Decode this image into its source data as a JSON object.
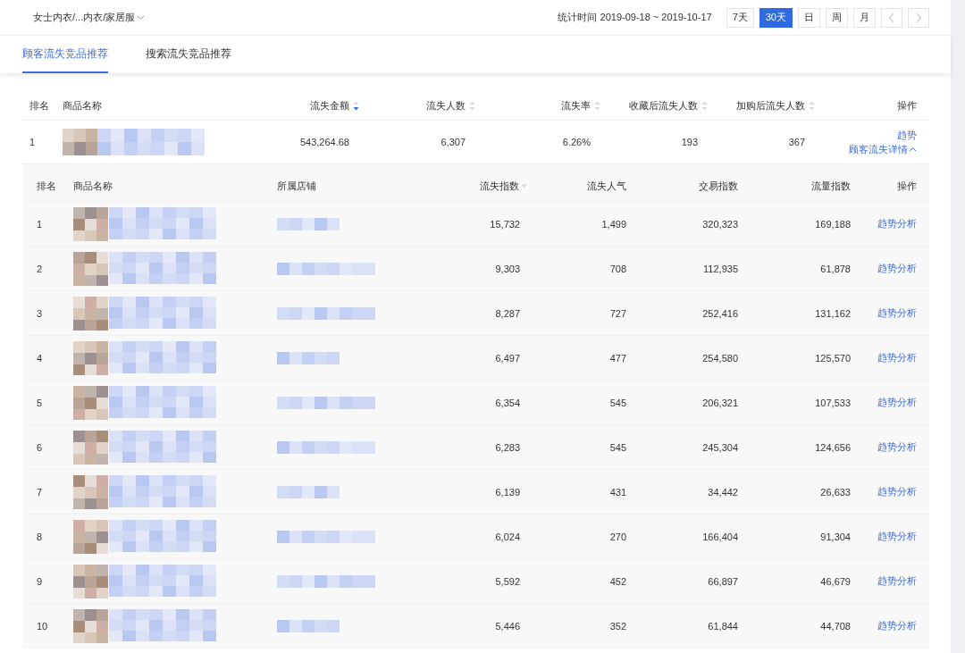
{
  "header": {
    "category": "女士内衣/...内衣/家居服",
    "period_label": "统计时间 2019-09-18 ~ 2019-10-17",
    "ranges": [
      {
        "label": "7天",
        "selected": false
      },
      {
        "label": "30天",
        "selected": true
      },
      {
        "label": "日",
        "selected": false
      },
      {
        "label": "周",
        "selected": false
      },
      {
        "label": "月",
        "selected": false
      }
    ],
    "prev_disabled": true,
    "next_disabled": true
  },
  "tabs": [
    {
      "label": "顾客流失竞品推荐",
      "selected": true
    },
    {
      "label": "搜索流失竞品推荐",
      "selected": false
    }
  ],
  "table": {
    "columns": [
      {
        "label": "排名",
        "sortable": false
      },
      {
        "label": "商品名称",
        "sortable": false
      },
      {
        "label": "流失金额",
        "sortable": true,
        "sorted_desc": true
      },
      {
        "label": "流失人数",
        "sortable": true,
        "sorted_desc": false
      },
      {
        "label": "流失率",
        "sortable": true,
        "sorted_desc": false
      },
      {
        "label": "收藏后流失人数",
        "sortable": true,
        "sorted_desc": false
      },
      {
        "label": "加购后流失人数",
        "sortable": true,
        "sorted_desc": false
      },
      {
        "label": "操作",
        "sortable": false
      }
    ],
    "rows": [
      {
        "rank": "1",
        "amount": "543,264.68",
        "lost_users": "6,307",
        "rate": "6.26%",
        "after_fav": "193",
        "after_cart": "367",
        "links": [
          "趋势",
          "顾客流失详情"
        ],
        "expanded": true
      }
    ]
  },
  "detail": {
    "columns": [
      "排名",
      "商品名称",
      "所属店铺",
      "流失指数",
      "流失人气",
      "交易指数",
      "流量指数",
      "操作"
    ],
    "rows": [
      {
        "rank": "1",
        "loss_index": "15,732",
        "popularity": "1,499",
        "trade_index": "320,323",
        "traffic_index": "169,188",
        "action": "趋势分析"
      },
      {
        "rank": "2",
        "loss_index": "9,303",
        "popularity": "708",
        "trade_index": "112,935",
        "traffic_index": "61,878",
        "action": "趋势分析"
      },
      {
        "rank": "3",
        "loss_index": "8,287",
        "popularity": "727",
        "trade_index": "252,416",
        "traffic_index": "131,162",
        "action": "趋势分析"
      },
      {
        "rank": "4",
        "loss_index": "6,497",
        "popularity": "477",
        "trade_index": "254,580",
        "traffic_index": "125,570",
        "action": "趋势分析"
      },
      {
        "rank": "5",
        "loss_index": "6,354",
        "popularity": "545",
        "trade_index": "206,321",
        "traffic_index": "107,533",
        "action": "趋势分析"
      },
      {
        "rank": "6",
        "loss_index": "6,283",
        "popularity": "545",
        "trade_index": "245,304",
        "traffic_index": "124,656",
        "action": "趋势分析"
      },
      {
        "rank": "7",
        "loss_index": "6,139",
        "popularity": "431",
        "trade_index": "34,442",
        "traffic_index": "26,633",
        "action": "趋势分析"
      },
      {
        "rank": "8",
        "loss_index": "6,024",
        "popularity": "270",
        "trade_index": "166,404",
        "traffic_index": "91,304",
        "action": "趋势分析"
      },
      {
        "rank": "9",
        "loss_index": "5,592",
        "popularity": "452",
        "trade_index": "66,897",
        "traffic_index": "46,679",
        "action": "趋势分析"
      },
      {
        "rank": "10",
        "loss_index": "5,446",
        "popularity": "352",
        "trade_index": "61,844",
        "traffic_index": "44,708",
        "action": "趋势分析"
      }
    ]
  }
}
